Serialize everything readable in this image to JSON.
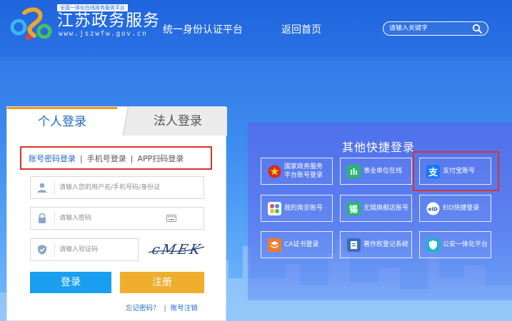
{
  "header": {
    "logo_small": "全国一体化在线政务服务平台",
    "title": "江苏政务服务",
    "url": "www.jszwfw.gov.cn",
    "nav": [
      "统一身份认证平台",
      "返回首页"
    ],
    "search_placeholder": "请输入关键字"
  },
  "login": {
    "tabs": [
      "个人登录",
      "法人登录"
    ],
    "methods": [
      "账号密码登录",
      "手机号登录",
      "APP扫码登录"
    ],
    "username_placeholder": "请输入您的用户名/手机号码/身份证",
    "password_placeholder": "请输入密码",
    "captcha_placeholder": "请输入验证码",
    "captcha_text": "cMEK",
    "login_button": "登录",
    "register_button": "注册",
    "forgot_link": "忘记密码？",
    "cancel_link": "账号注销"
  },
  "quick": {
    "title": "其他快捷登录",
    "items": [
      {
        "label": "国家政务服务\n平台账号登录",
        "line1": "国家政务服务",
        "line2": "平台账号登录",
        "icon": "national-emblem-icon",
        "color": "#d62b20"
      },
      {
        "label": "事业单位在线",
        "icon": "institution-icon",
        "color": "#2bb673"
      },
      {
        "label": "支付宝账号",
        "icon": "alipay-icon",
        "color": "#1677ff"
      },
      {
        "label": "我的南京账号",
        "icon": "nanjing-icon",
        "color": "#ffffff"
      },
      {
        "label": "无锡旗舰店账号",
        "icon": "wuxi-icon",
        "color": "#2bb673"
      },
      {
        "label": "EID快捷登录",
        "icon": "eid-icon",
        "color": "#ffffff"
      },
      {
        "label": "CA证书登录",
        "icon": "ca-certificate-icon",
        "color": "#f07a2a"
      },
      {
        "label": "著作权登记系统",
        "icon": "copyright-icon",
        "color": "#3a6fb8"
      },
      {
        "label": "公安一体化平台",
        "icon": "police-icon",
        "color": "#20b5c8"
      }
    ]
  }
}
